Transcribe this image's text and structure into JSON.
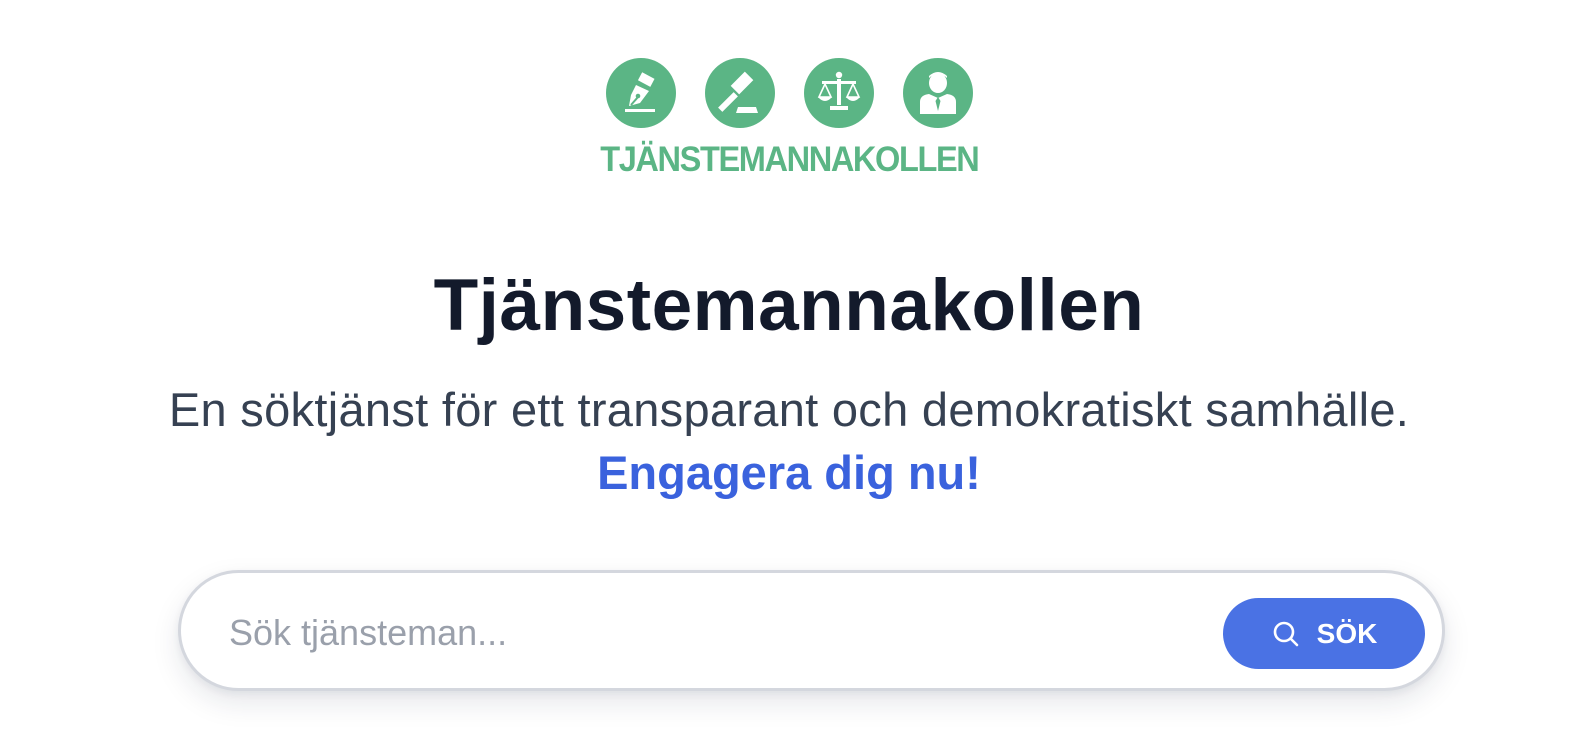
{
  "logo": {
    "wordmark": "TJÄNSTEMANNAKOLLEN",
    "icons": [
      "pen-icon",
      "gavel-icon",
      "scales-icon",
      "official-icon"
    ],
    "color": "#5bb585"
  },
  "hero": {
    "title": "Tjänstemannakollen",
    "tagline": "En söktjänst för ett transparant och demokratiskt samhälle.",
    "cta_link": "Engagera dig nu!"
  },
  "search": {
    "placeholder": "Sök tjänsteman...",
    "value": "",
    "button_label": "SÖK",
    "button_icon": "search-icon",
    "button_color": "#4a72e4"
  },
  "colors": {
    "title": "#131a2b",
    "tagline": "#364152",
    "link": "#3a62dd"
  }
}
